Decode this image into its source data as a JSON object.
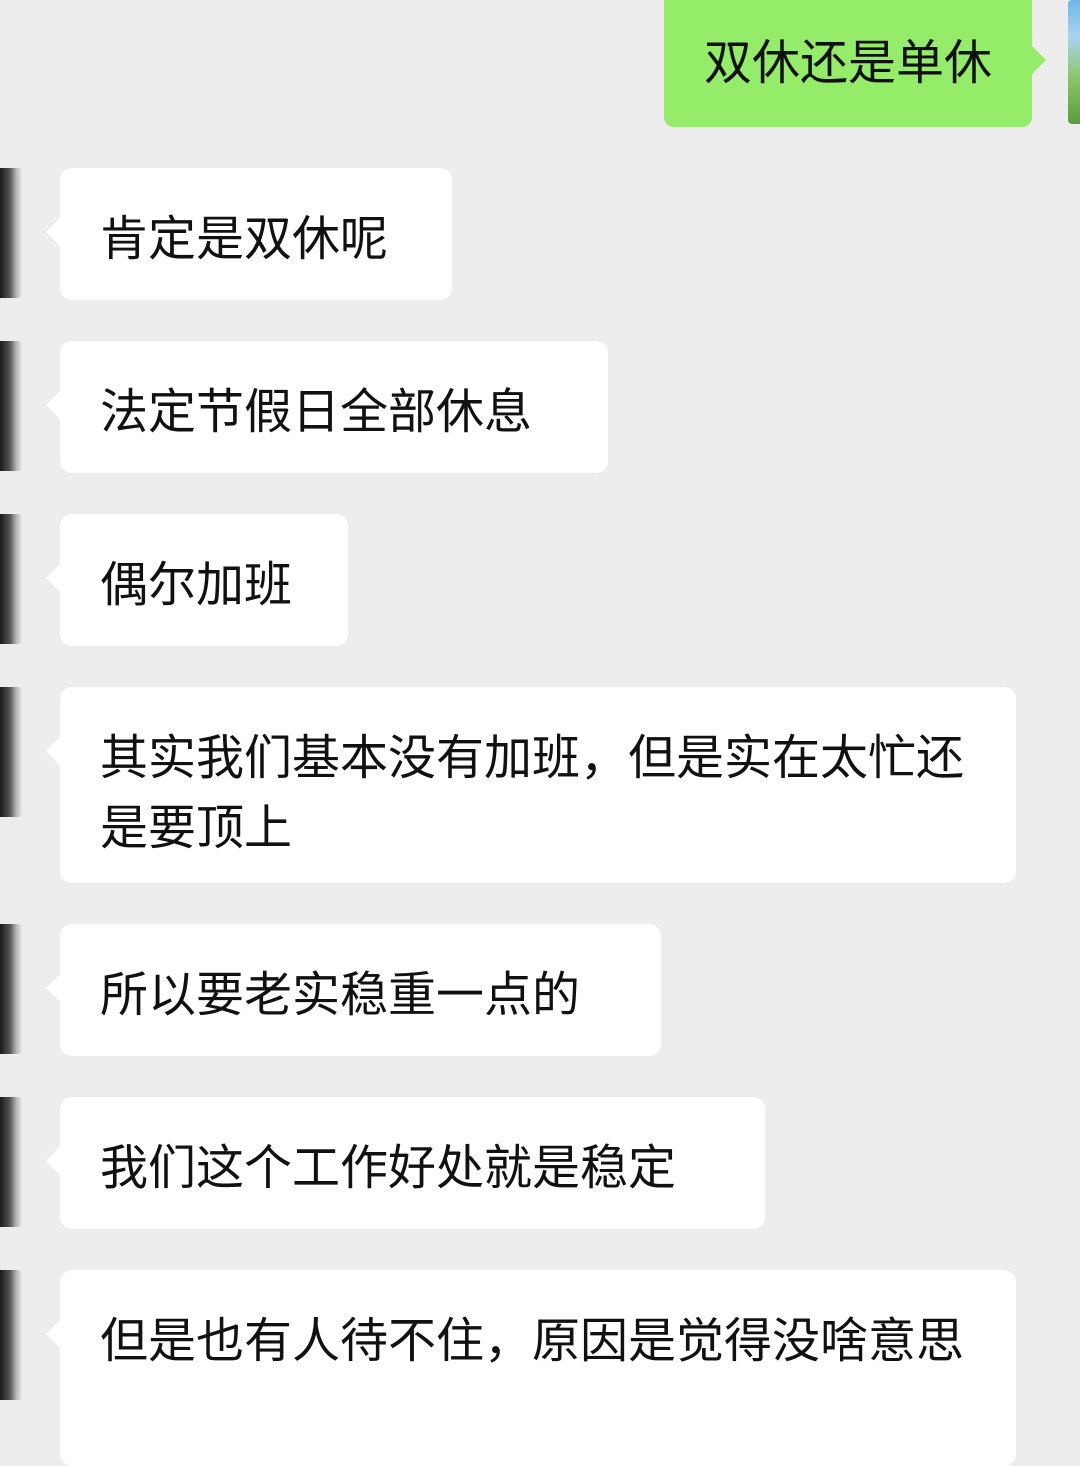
{
  "messages": [
    {
      "direction": "outgoing",
      "text": "双休还是单休"
    },
    {
      "direction": "incoming",
      "text": "肯定是双休呢"
    },
    {
      "direction": "incoming",
      "text": "法定节假日全部休息"
    },
    {
      "direction": "incoming",
      "text": "偶尔加班"
    },
    {
      "direction": "incoming",
      "text": "其实我们基本没有加班，但是实在太忙还是要顶上"
    },
    {
      "direction": "incoming",
      "text": "所以要老实稳重一点的"
    },
    {
      "direction": "incoming",
      "text": "我们这个工作好处就是稳定"
    },
    {
      "direction": "incoming",
      "text": "但是也有人待不住，原因是觉得没啥意思"
    }
  ],
  "colors": {
    "background": "#ededed",
    "outgoing_bubble": "#95ec69",
    "incoming_bubble": "#ffffff",
    "text": "#111111"
  },
  "icons": {
    "self_avatar": "avatar-image",
    "contact_avatar": "avatar-image"
  }
}
